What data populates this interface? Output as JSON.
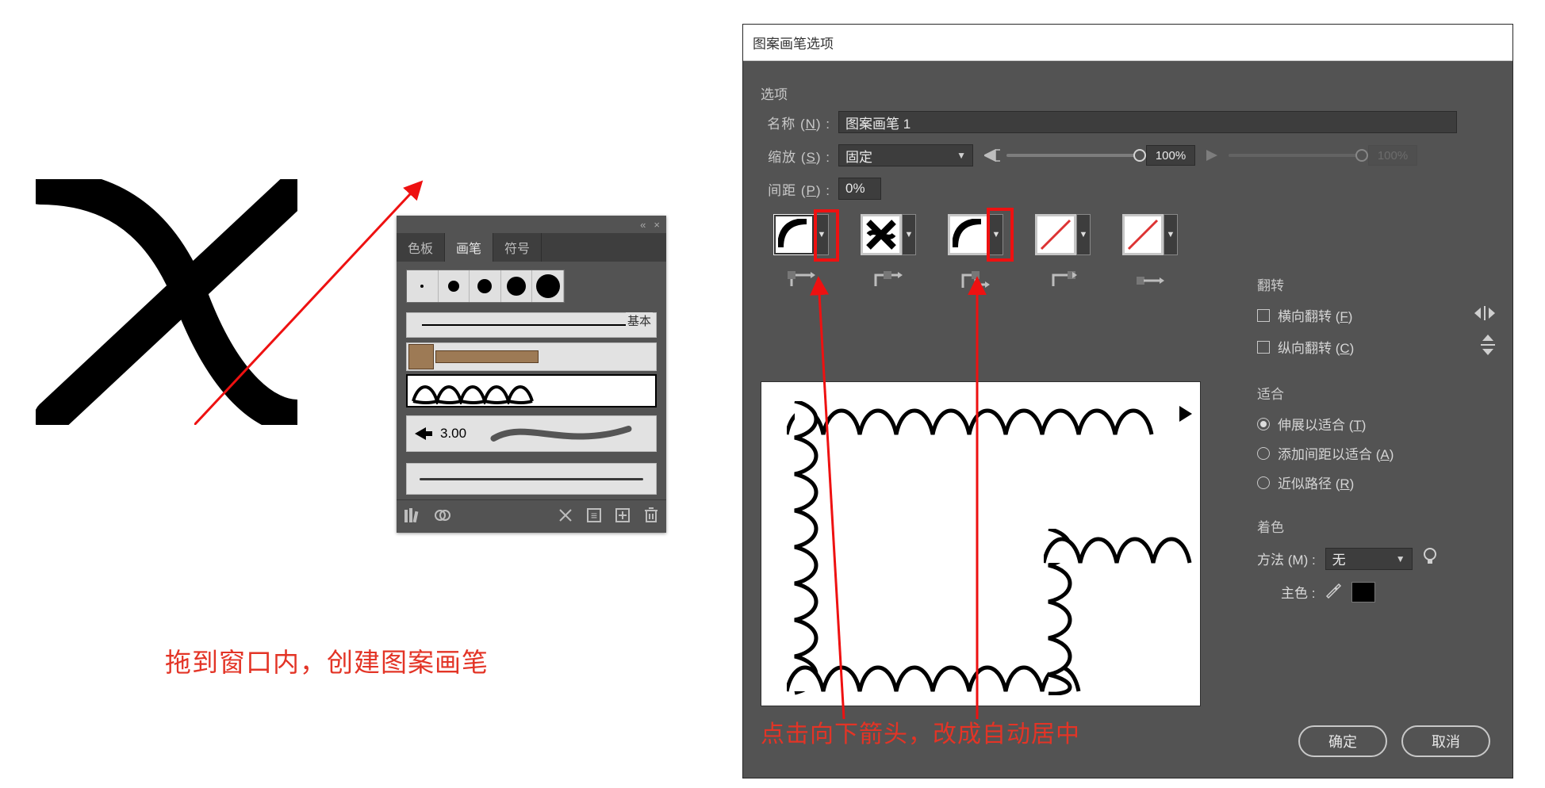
{
  "panel": {
    "collapse_icon": "«",
    "close_icon": "×",
    "tabs": {
      "swatches": "色板",
      "brushes": "画笔",
      "symbols": "符号"
    },
    "basic_label": "基本",
    "art_brush_size": "3.00"
  },
  "caption_drag": "拖到窗口内，创建图案画笔",
  "dialog": {
    "title": "图案画笔选项",
    "options_heading": "选项",
    "name_label": "名称 (",
    "name_key": "N",
    "name_label_end": ") :",
    "name_value": "图案画笔 1",
    "scale_label": "缩放 (",
    "scale_key": "S",
    "scale_label_end": ") :",
    "scale_mode": "固定",
    "scale_pct_a": "100%",
    "scale_pct_b": "100%",
    "spacing_label": "间距 (",
    "spacing_key": "P",
    "spacing_label_end": ") :",
    "spacing_value": "0%",
    "flip": {
      "heading": "翻转",
      "h_label": "横向翻转 (",
      "h_key": "F",
      "h_label_end": ")",
      "v_label": "纵向翻转 (",
      "v_key": "C",
      "v_label_end": ")"
    },
    "fit": {
      "heading": "适合",
      "stretch": "伸展以适合 (",
      "stretch_key": "T",
      "stretch_end": ")",
      "addspace": "添加间距以适合 (",
      "addspace_key": "A",
      "addspace_end": ")",
      "approx": "近似路径 (",
      "approx_key": "R",
      "approx_end": ")"
    },
    "coloring": {
      "heading": "着色",
      "method_label": "方法 (",
      "method_key": "M",
      "method_end": ") :",
      "method_value": "无",
      "key_color_label": "主色 :"
    },
    "ok": "确定",
    "cancel": "取消"
  },
  "caption_arrow": "点击向下箭头，改成自动居中"
}
